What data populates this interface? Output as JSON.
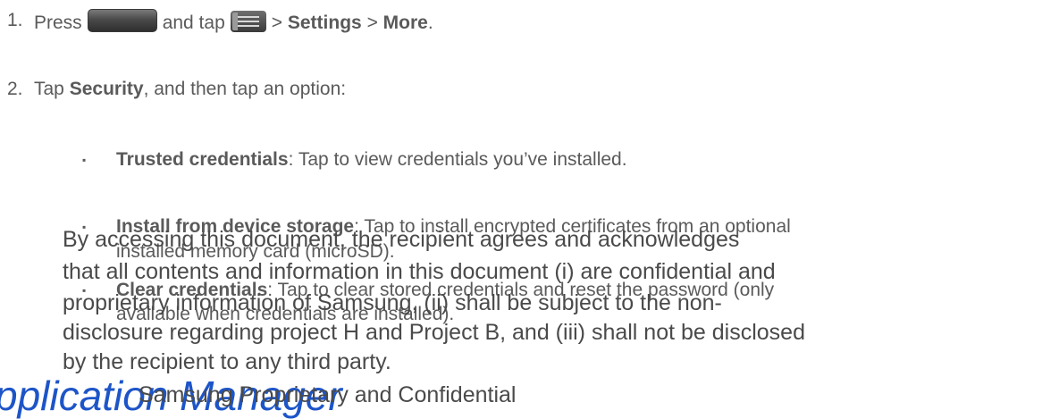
{
  "steps": [
    {
      "number": "1.",
      "parts": {
        "press": "Press",
        "and_tap": "and tap",
        "sep1": ">",
        "settings": "Settings",
        "sep2": ">",
        "more": "More",
        "end": "."
      },
      "icons": [
        "home-key-icon",
        "menu-key-icon"
      ]
    },
    {
      "number": "2.",
      "parts": {
        "tap": "Tap",
        "security": "Security",
        "rest": ", and then tap an option:"
      }
    }
  ],
  "options": [
    {
      "bullet": "▪",
      "title": "Trusted credentials",
      "desc": ": Tap to view credentials you’ve installed."
    },
    {
      "bullet": "▪",
      "title": "Install from device storage",
      "desc": ": Tap to install encrypted certificates from an optional",
      "cont": "installed memory card (microSD)."
    },
    {
      "bullet": "▪",
      "title": "Clear credentials",
      "desc": ": Tap to clear stored credentials and reset the password (only",
      "cont": "available when credentials are installed)."
    }
  ],
  "confidential_notice": [
    "By accessing this document, the recipient agrees and acknowledges",
    "that all contents and information in this document (i) are confidential and",
    "proprietary information of Samsung, (ii) shall be subject to the non-",
    "disclosure regarding project H and Project B, and (iii) shall not be disclosed",
    "by the recipient to any third party."
  ],
  "footer": {
    "banner": "pplication Manager",
    "samsung": "Samsung Proprietary and Confidential"
  },
  "colors": {
    "text": "#5a5a5a",
    "banner": "#1d55c8"
  }
}
